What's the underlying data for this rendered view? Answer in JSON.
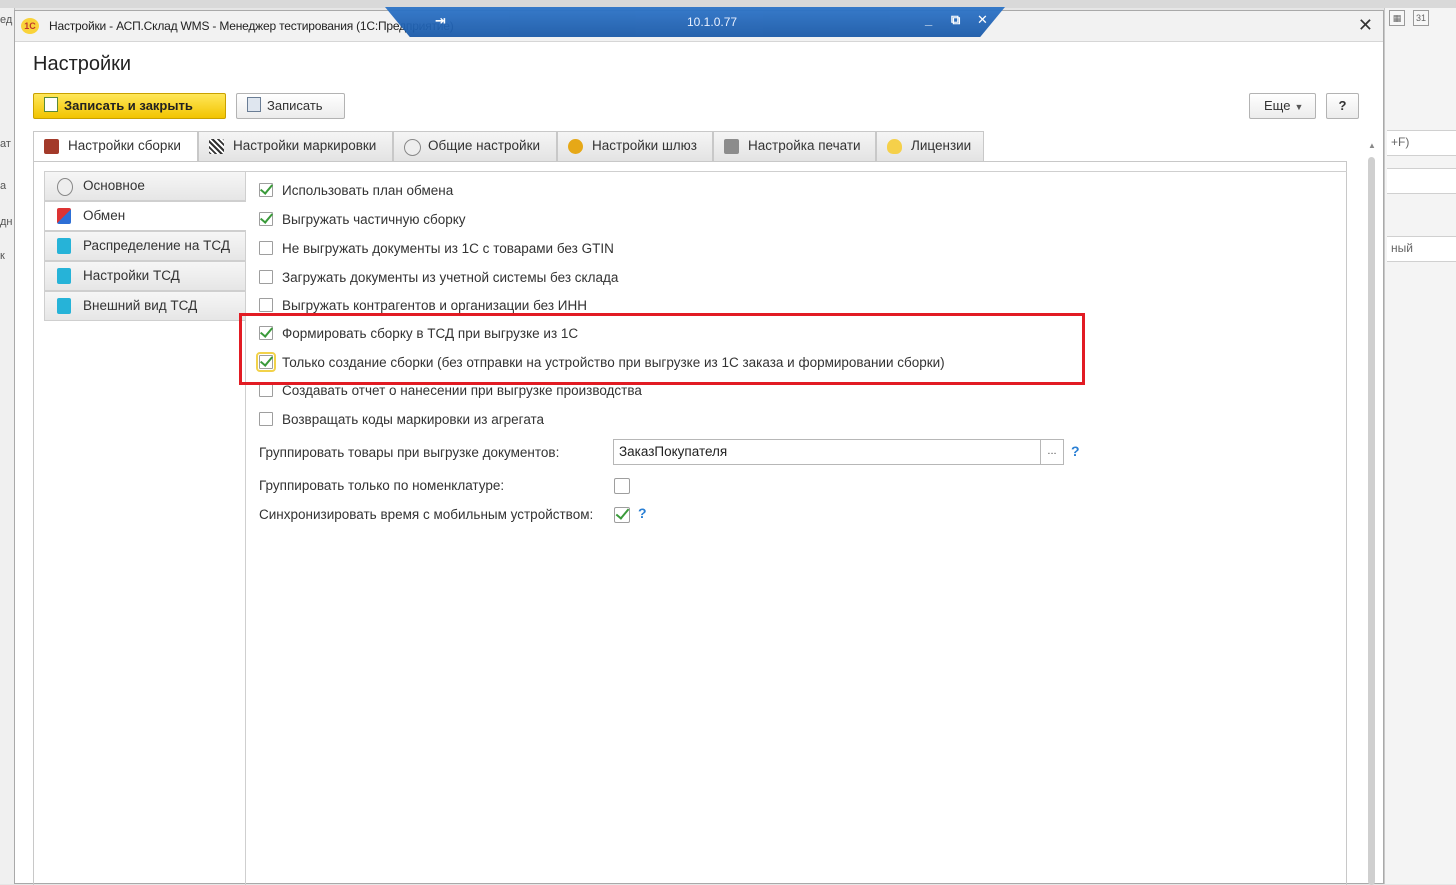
{
  "background": {
    "left_fragments": [
      "ед",
      "ат",
      "а",
      "дн",
      "к"
    ],
    "right_fragments": [
      "+F)",
      "ный"
    ]
  },
  "window": {
    "title": "Настройки - АСП.Склад WMS  - Менеджер тестирования (1С:Предприятие)",
    "logo": "1С",
    "close_glyph": "✕"
  },
  "remote_bar": {
    "pin": "⇥",
    "ip": "10.1.0.77",
    "minimize": "_",
    "restore": "⧉",
    "close": "✕"
  },
  "form": {
    "title": "Настройки"
  },
  "toolbar": {
    "save_close_label": "Записать и закрыть",
    "save_label": "Записать",
    "more_label": "Еще",
    "help_label": "?"
  },
  "tabs": [
    {
      "label": "Настройки сборки",
      "icon": "assembly-settings-icon",
      "active": true
    },
    {
      "label": "Настройки маркировки",
      "icon": "qr-code-icon",
      "active": false
    },
    {
      "label": "Общие настройки",
      "icon": "gear-icon",
      "active": false
    },
    {
      "label": "Настройки шлюз",
      "icon": "gateway-gear-icon",
      "active": false
    },
    {
      "label": "Настройка печати",
      "icon": "printer-icon",
      "active": false
    },
    {
      "label": "Лицензии",
      "icon": "lightbulb-icon",
      "active": false
    }
  ],
  "sidebar": {
    "items": [
      {
        "label": "Основное",
        "icon": "gear-icon",
        "active": false
      },
      {
        "label": "Обмен",
        "icon": "exchange-icon",
        "active": true
      },
      {
        "label": "Распределение на ТСД",
        "icon": "mobile-device-icon",
        "active": false
      },
      {
        "label": "Настройки ТСД",
        "icon": "mobile-device-icon",
        "active": false
      },
      {
        "label": "Внешний вид ТСД",
        "icon": "mobile-device-icon",
        "active": false
      }
    ]
  },
  "options": [
    {
      "label": "Использовать план обмена",
      "checked": true
    },
    {
      "label": "Выгружать частичную сборку",
      "checked": true
    },
    {
      "label": "Не выгружать документы из 1С с товарами без GTIN",
      "checked": false
    },
    {
      "label": "Загружать документы из учетной системы без склада",
      "checked": false
    },
    {
      "label": "Выгружать контрагентов и организации без ИНН",
      "checked": false
    },
    {
      "label": "Формировать сборку в ТСД при выгрузке из 1С",
      "checked": true
    },
    {
      "label": "Только создание сборки (без отправки на устройство при выгрузке из 1С заказа и формировании сборки)",
      "checked": true
    },
    {
      "label": "Создавать отчет о нанесении при выгрузке производства",
      "checked": false
    },
    {
      "label": "Возвращать коды маркировки из агрегата",
      "checked": false
    }
  ],
  "grouping": {
    "label": "Группировать товары при выгрузке документов:",
    "value": "ЗаказПокупателя",
    "select_btn": "...",
    "help": "?"
  },
  "group_by_nomenclature": {
    "label": "Группировать только по номенклатуре:",
    "checked": false
  },
  "sync_time": {
    "label": "Синхронизировать время с мобильным устройством:",
    "checked": true,
    "help": "?"
  },
  "colors": {
    "primary_button": "#f2c400",
    "check_green": "#3a9a3a",
    "highlight_red": "#e21b23",
    "help_blue": "#2a7fd4",
    "rdp_blue": "#1b5aa8"
  }
}
